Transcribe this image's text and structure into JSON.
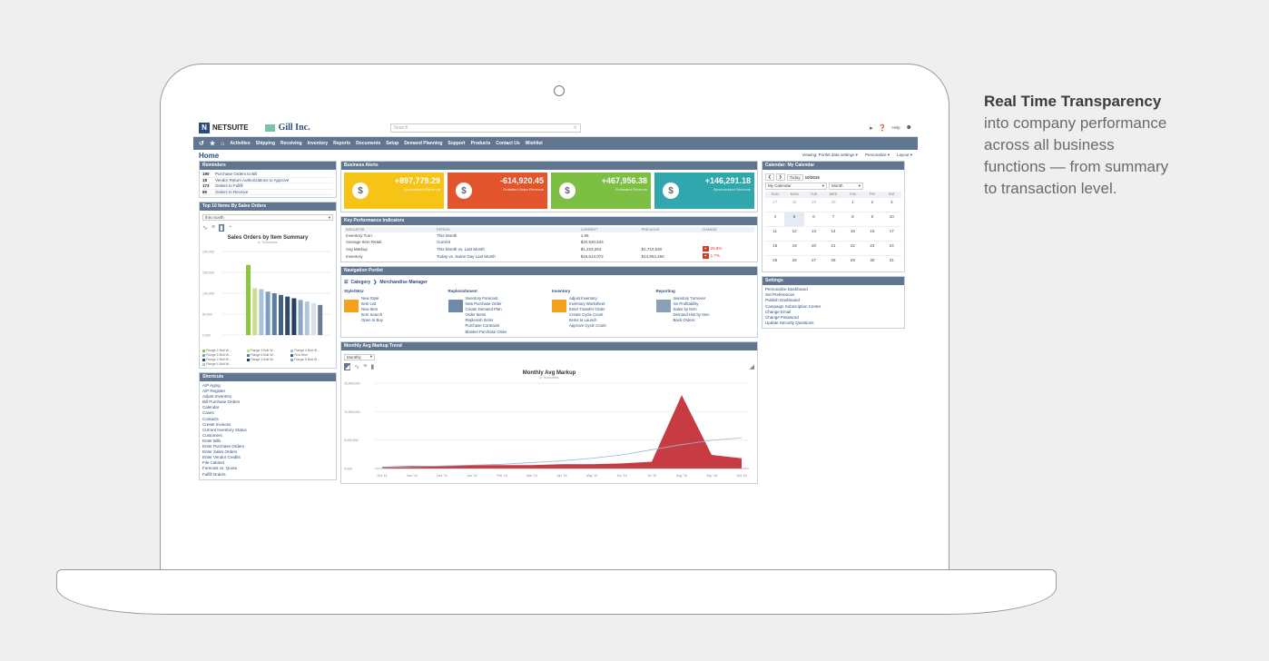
{
  "side_copy": {
    "headline": "Real Time Transparency",
    "lines": [
      "into company performance",
      "across all business",
      "functions — from summary",
      "to transaction level."
    ]
  },
  "header": {
    "logo": "NETSUITE",
    "company": "Gill Inc.",
    "search_placeholder": "Search",
    "help": "Help"
  },
  "nav": [
    "Activities",
    "Shipping",
    "Receiving",
    "Inventory",
    "Reports",
    "Documents",
    "Setup",
    "Demand Planning",
    "Support",
    "Products",
    "Contact Us",
    "Wishlist"
  ],
  "page": {
    "title": "Home",
    "viewing": "Viewing: Portlet data settings ▾",
    "personalize": "Personalize ▾",
    "layout": "Layout ▾"
  },
  "reminders": {
    "title": "Reminders",
    "items": [
      {
        "count": "190",
        "label": "Purchase Orders to Bill"
      },
      {
        "count": "18",
        "label": "Vendor Return Authorizations to Approve"
      },
      {
        "count": "173",
        "label": "Orders to Fulfill"
      },
      {
        "count": "89",
        "label": "Orders to Receive"
      }
    ]
  },
  "top_items": {
    "title": "Top 10 Items By Sales Orders",
    "filter": "this month",
    "chart_title": "Sales Orders by Item Summary",
    "chart_subtitle": "in Thousands",
    "yticks": [
      "200,000",
      "150,000",
      "100,000",
      "50,000",
      "0,000"
    ],
    "bars": [
      0.84,
      0.56,
      0.55,
      0.52,
      0.5,
      0.48,
      0.46,
      0.44,
      0.42,
      0.4,
      0.38,
      0.36
    ],
    "bar_colors": [
      "#8cc63f",
      "#c8e08a",
      "#a8c3d9",
      "#7d9fbf",
      "#5c7fa3",
      "#3f6187",
      "#2e4b6e",
      "#25405f",
      "#8aa8c4",
      "#b4c7d8",
      "#d7e1ea",
      "#6a7d92"
    ],
    "legend": [
      "Flange 2 Bolt W...",
      "Flange 3 Bolt W...",
      "Flange 4 Bolt W...",
      "Flange 5 Bolt W...",
      "Flange 6 Bolt W...",
      "Rod Wire",
      "Flange 2 Bolt W...",
      "Flange 3 Bolt W...",
      "Flange 5 Bolt W...",
      "Flange 4 Bolt W..."
    ]
  },
  "shortcuts": {
    "title": "Shortcuts",
    "items": [
      "A/P Aging",
      "A/P Register",
      "Adjust Inventory",
      "Bill Purchase Orders",
      "Calendar",
      "Cases",
      "Contacts",
      "Create Invoices",
      "Current Inventory Status",
      "Customers",
      "Enter Bills",
      "Enter Purchase Orders",
      "Enter Sales Orders",
      "Enter Vendor Credits",
      "File Cabinet",
      "Forecast vs. Quota",
      "Fulfill Orders"
    ]
  },
  "business_alerts": {
    "title": "Business Alerts",
    "cards": [
      {
        "amount": "+897,779.29",
        "label": "Accumulated Revenue",
        "color": "#f5c416"
      },
      {
        "amount": "-614,920.45",
        "label": "Outdated Sales Revenue",
        "color": "#e2542b"
      },
      {
        "amount": "+467,956.38",
        "label": "Estimated Revenue",
        "color": "#7dbf43"
      },
      {
        "amount": "+146,291.18",
        "label": "Synchronized Revenue",
        "color": "#2fa7ac"
      }
    ]
  },
  "kpi": {
    "title": "Key Performance Indicators",
    "headers": [
      "INDICATOR",
      "PERIOD",
      "CURRENT",
      "PREVIOUS",
      "CHANGE"
    ],
    "rows": [
      {
        "indicator": "Inventory Turn",
        "period": "This Month",
        "current": "1.65",
        "previous": "",
        "change": ""
      },
      {
        "indicator": "Average Item Retail",
        "period": "Current",
        "current": "$20,530,534",
        "previous": "",
        "change": ""
      },
      {
        "indicator": "Avg Markup",
        "period": "This Month vs. Last Month",
        "current": "$1,223,264",
        "previous": "$1,710,530",
        "change": "28.8%"
      },
      {
        "indicator": "Inventory",
        "period": "Today vs. Same Day Last Month",
        "current": "$16,613,072",
        "previous": "$14,904,450",
        "change": "1.7%"
      }
    ]
  },
  "nav_portlet": {
    "title": "Navigation Portlet",
    "crumb_root": "Category",
    "crumb_current": "Merchandise Manager",
    "groups": [
      {
        "title": "Style/SKU",
        "links": [
          "New Style",
          "Item List",
          "New Item",
          "Item Search",
          "Open to Buy"
        ]
      },
      {
        "title": "Replenishment",
        "links": [
          "Inventory Forecast",
          "New Purchase Order",
          "Create Demand Plan",
          "Order Items",
          "Replenish Items",
          "Purchase Contracts",
          "Blanket Purchase Order"
        ]
      },
      {
        "title": "Inventory",
        "links": [
          "Adjust Inventory",
          "Inventory Worksheet",
          "Enter Transfer Order",
          "Create Cycle Count",
          "Items to Launch",
          "Approve Cycle Count"
        ]
      },
      {
        "title": "Reporting",
        "links": [
          "Inventory Turnover",
          "Inv Profitability",
          "Sales by Item",
          "Demand Hist by Item",
          "Back Orders"
        ]
      }
    ]
  },
  "markup_trend": {
    "title": "Monthly Avg Markup Trend",
    "filter": "Monthly",
    "chart_title": "Monthly Avg Markup",
    "chart_subtitle": "in Thousands",
    "yticks": [
      "15,000,000",
      "10,000,000",
      "5,000,000",
      "0.000"
    ],
    "xticks": [
      "Oct '14",
      "Nov '14",
      "Dec '14",
      "Jan '15",
      "Feb '15",
      "Mar '15",
      "Apr '15",
      "May '15",
      "Jun '15",
      "Jul '15",
      "Aug '15",
      "Sep '15",
      "Oct '15"
    ]
  },
  "calendar": {
    "title": "Calendar: My Calendar",
    "today": "Today",
    "month_label": "10/2015",
    "calendar_select": "My Calendar",
    "view_select": "Month",
    "days": [
      "SUN",
      "MON",
      "TUE",
      "WED",
      "THU",
      "FRI",
      "SAT"
    ],
    "weeks": [
      [
        "27",
        "28",
        "29",
        "30",
        "1",
        "2",
        "3"
      ],
      [
        "4",
        "5",
        "6",
        "7",
        "8",
        "9",
        "10"
      ],
      [
        "11",
        "12",
        "13",
        "14",
        "15",
        "16",
        "17"
      ],
      [
        "18",
        "19",
        "20",
        "21",
        "22",
        "23",
        "24"
      ],
      [
        "25",
        "26",
        "27",
        "28",
        "29",
        "30",
        "31"
      ]
    ]
  },
  "settings": {
    "title": "Settings",
    "items": [
      "Personalize Dashboard",
      "Set Preferences",
      "Publish Dashboard",
      "Campaign Subscription Center",
      "Change Email",
      "Change Password",
      "Update Security Questions"
    ]
  }
}
